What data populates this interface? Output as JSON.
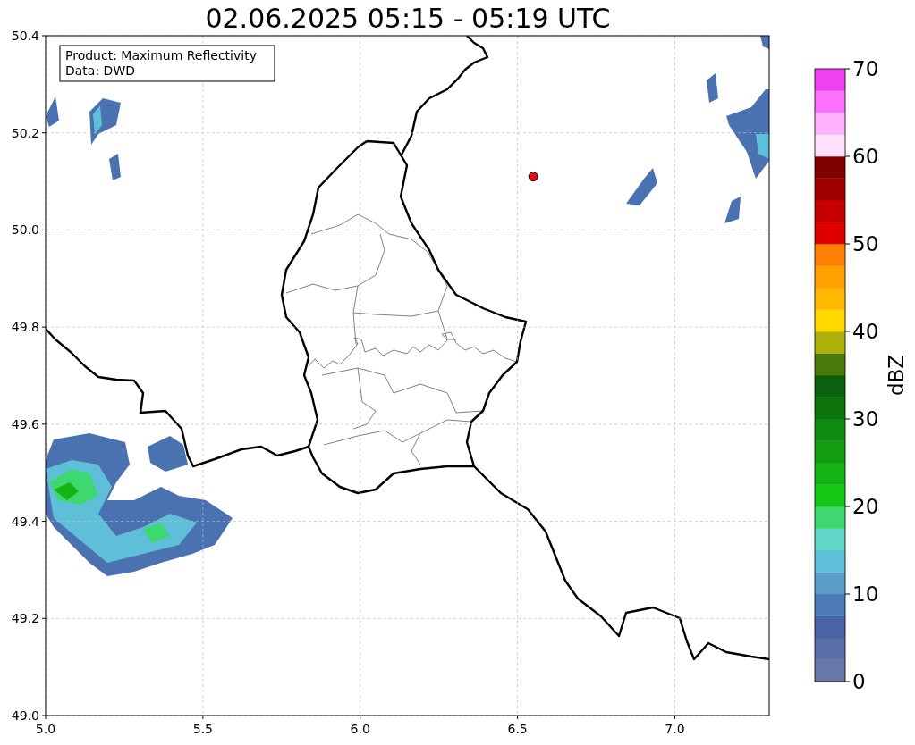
{
  "figure": {
    "title": "02.06.2025 05:15 - 05:19 UTC",
    "info_box": [
      "Product: Maximum Reflectivity",
      "Data: DWD"
    ],
    "map": {
      "chart_data": {
        "type": "scatter",
        "grid": true,
        "x": [
          6.55
        ],
        "values": [
          50.11
        ],
        "xlim": [
          5.0,
          7.3
        ],
        "ylim": [
          49.0,
          50.4
        ],
        "xticks": [
          {
            "value": 5.0,
            "label": "5.0"
          },
          {
            "value": 5.5,
            "label": "5.5"
          },
          {
            "value": 6.0,
            "label": "6.0"
          },
          {
            "value": 6.5,
            "label": "6.5"
          },
          {
            "value": 7.0,
            "label": "7.0"
          }
        ],
        "yticks": [
          {
            "value": 49.0,
            "label": "49.0"
          },
          {
            "value": 49.2,
            "label": "49.2"
          },
          {
            "value": 49.4,
            "label": "49.4"
          },
          {
            "value": 49.6,
            "label": "49.6"
          },
          {
            "value": 49.8,
            "label": "49.8"
          },
          {
            "value": 50.0,
            "label": "50.0"
          },
          {
            "value": 50.2,
            "label": "50.2"
          },
          {
            "value": 50.4,
            "label": "50.4"
          }
        ]
      }
    },
    "colorbar": {
      "label": "dBZ",
      "ticks": [
        "70",
        "60",
        "50",
        "40",
        "30",
        "20",
        "10",
        "0"
      ],
      "bands": [
        {
          "color": "#6677a8"
        },
        {
          "color": "#5a6ea8"
        },
        {
          "color": "#4a62a6"
        },
        {
          "color": "#4a7bb6"
        },
        {
          "color": "#5a9ec8"
        },
        {
          "color": "#5fbfd8"
        },
        {
          "color": "#5fd8c8"
        },
        {
          "color": "#3ed870"
        },
        {
          "color": "#14c814"
        },
        {
          "color": "#14b414"
        },
        {
          "color": "#109e10"
        },
        {
          "color": "#0e8a0e"
        },
        {
          "color": "#0c750c"
        },
        {
          "color": "#0b600b"
        },
        {
          "color": "#4a7a0a"
        },
        {
          "color": "#b0b00a"
        },
        {
          "color": "#ffd800"
        },
        {
          "color": "#ffb800"
        },
        {
          "color": "#ffa000"
        },
        {
          "color": "#ff8000"
        },
        {
          "color": "#e00000"
        },
        {
          "color": "#c80000"
        },
        {
          "color": "#a00000"
        },
        {
          "color": "#800000"
        },
        {
          "color": "#ffe0ff"
        },
        {
          "color": "#ffb0ff"
        },
        {
          "color": "#ff70ff"
        },
        {
          "color": "#f040f0"
        }
      ]
    }
  }
}
